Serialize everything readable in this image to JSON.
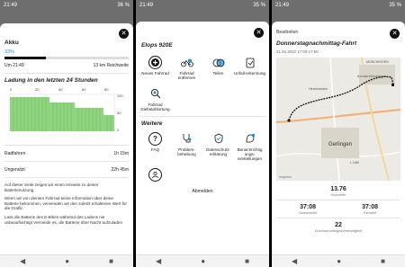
{
  "screen1": {
    "status": {
      "time": "21:49",
      "battery": "36 %"
    },
    "akku": {
      "title": "Akku",
      "percent": "33%",
      "percent_value": 33,
      "time_label": "Um 21:49",
      "range": "13 km Reichweite"
    },
    "ladung": {
      "title": "Ladung in den letzten 24 Stunden",
      "x_ticks": [
        "0",
        "20",
        "40",
        "60",
        "80"
      ],
      "y_ticks": [
        "100",
        "50",
        "0"
      ]
    },
    "stats": [
      {
        "label": "Radfahren",
        "value": "1h 15m"
      },
      {
        "label": "Ungenutzt",
        "value": "22h 45m"
      }
    ],
    "info": [
      "Auf dieser Seite zeigen wir einen Hinweis zu deiner Batterienutzung.",
      "Wenn wir von deinem Fahrrad keine Information über deine Batterie bekommen, verwenden wir den zuletzt erhaltenen Wert für die Grafik.",
      "Lass die Batterie des E-Bikes während des Ladens nie unbeaufsichtigt Vermeide es, die Batterie über Nacht aufzuladen"
    ]
  },
  "screen2": {
    "status": {
      "time": "21:49",
      "battery": "35 %"
    },
    "title": "Elops 920E",
    "bike_actions": [
      {
        "label": "Neues Fahrrad",
        "icon": "plus-icon"
      },
      {
        "label": "Fahrrad entfernen",
        "icon": "bike-remove-icon"
      },
      {
        "label": "Teilen",
        "icon": "share-icon"
      },
      {
        "label": "Unfall-erkennung",
        "icon": "accident-icon"
      },
      {
        "label": "Fahrrad Diebstahlortung",
        "icon": "theft-search-icon"
      }
    ],
    "more_title": "Weitere",
    "more_actions": [
      {
        "label": "FAQ",
        "icon": "question-icon"
      },
      {
        "label": "Problem-behebung",
        "icon": "stethoscope-icon"
      },
      {
        "label": "Datenschutz-erklärung",
        "icon": "privacy-icon"
      },
      {
        "label": "Benachrichtig ungs-einstellungen",
        "icon": "notification-icon"
      }
    ],
    "logout": "Abmelden"
  },
  "screen3": {
    "status": {
      "time": "21:49",
      "battery": "35 %"
    },
    "edit": "Bearbeiten",
    "title": "Donnerstagnachmittag-Fahrt",
    "date": "21.04.2022 17:00-17:50",
    "map_labels": {
      "city": "Gerlingen",
      "place1": "Hirschlanden",
      "place2": "Korntal-Münchingen",
      "town_top": "MÜNCHINGEN",
      "road": "L 1180",
      "brand": "mapbox"
    },
    "distance": {
      "value": "13.76",
      "label": "Kilometer"
    },
    "time_total": {
      "value": "37:08",
      "label": "Gesamtzeit"
    },
    "time_ride": {
      "value": "37:08",
      "label": "Fahrzeit"
    },
    "speed": {
      "value": "22",
      "label": "Durchschnittsgeschwindigkeit"
    }
  }
}
